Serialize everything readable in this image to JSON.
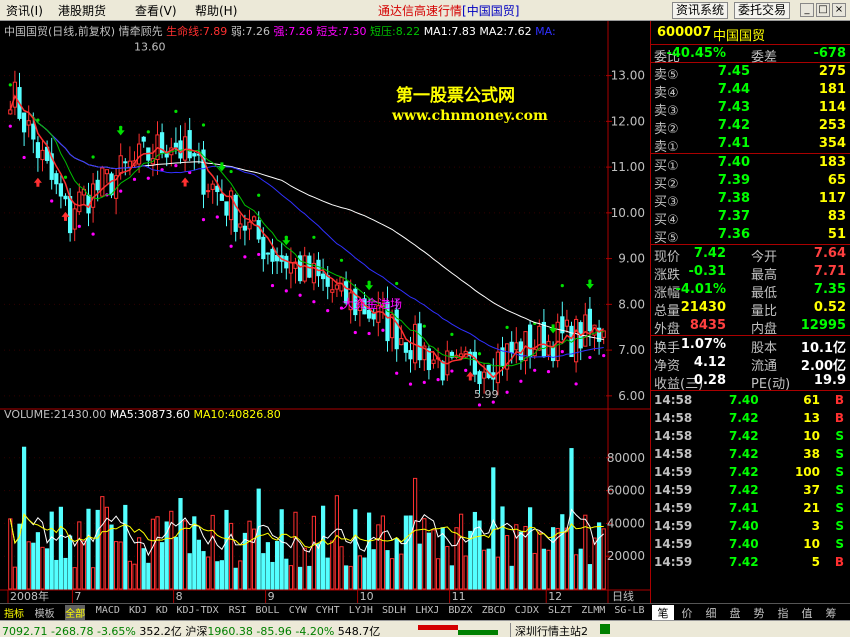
{
  "menu": {
    "items": [
      "资讯(I)",
      "港股期货",
      "查看(V)",
      "帮助(H)"
    ],
    "app_title": "通达信高速行情",
    "app_subtitle": "[中国国贸]",
    "btn_info": "资讯系统",
    "btn_trade": "委托交易"
  },
  "chart_header": {
    "title": "中国国贸(日线,前复权)",
    "indicator": "情牵顾先",
    "lifeline_label": "生命线:",
    "lifeline": "7.89",
    "weak_label": "弱:",
    "weak": "7.26",
    "strong_label": "强:",
    "strong": "7.26",
    "short_label": "短支:",
    "short": "7.30",
    "shortpress_label": "短压:",
    "shortpress": "8.22",
    "ma1_label": "MA1:",
    "ma1": "7.83",
    "ma2_label": "MA2:",
    "ma2": "7.62",
    "ma3_label": "MA:"
  },
  "watermark": {
    "line1": "第一股票公式网",
    "line2": "www.chnmoney.com",
    "note": "大资金进场"
  },
  "price_axis": [
    "13.00",
    "12.00",
    "11.00",
    "10.00",
    "9.00",
    "8.00",
    "7.00",
    "6.00"
  ],
  "high_marker": "13.60",
  "low_marker": "5.99",
  "volume_header": {
    "vol_label": "VOLUME:",
    "vol": "21430.00",
    "ma5_label": "MA5:",
    "ma5": "30873.60",
    "ma10_label": "MA10:",
    "ma10": "40826.80"
  },
  "volume_axis": [
    "80000",
    "60000",
    "40000",
    "20000"
  ],
  "month_labels": [
    "2008年",
    "7",
    "8",
    "9",
    "10",
    "11",
    "12"
  ],
  "period_label": "日线",
  "quote": {
    "code": "600007",
    "name": "中国国贸",
    "ratio_label": "委比",
    "ratio": "-40.45%",
    "diff_label": "委差",
    "diff": "-678",
    "asks": [
      {
        "label": "卖⑤",
        "price": "7.45",
        "vol": "275"
      },
      {
        "label": "卖④",
        "price": "7.44",
        "vol": "181"
      },
      {
        "label": "卖③",
        "price": "7.43",
        "vol": "114"
      },
      {
        "label": "卖②",
        "price": "7.42",
        "vol": "253"
      },
      {
        "label": "卖①",
        "price": "7.41",
        "vol": "354"
      }
    ],
    "bids": [
      {
        "label": "买①",
        "price": "7.40",
        "vol": "183"
      },
      {
        "label": "买②",
        "price": "7.39",
        "vol": "65"
      },
      {
        "label": "买③",
        "price": "7.38",
        "vol": "117"
      },
      {
        "label": "买④",
        "price": "7.37",
        "vol": "83"
      },
      {
        "label": "买⑤",
        "price": "7.36",
        "vol": "51"
      }
    ],
    "stats": [
      {
        "l1": "现价",
        "v1": "7.42",
        "c1": "#00ff00",
        "l2": "今开",
        "v2": "7.64",
        "c2": "#ff4040"
      },
      {
        "l1": "涨跌",
        "v1": "-0.31",
        "c1": "#00ff00",
        "l2": "最高",
        "v2": "7.71",
        "c2": "#ff4040"
      },
      {
        "l1": "涨幅",
        "v1": "-4.01%",
        "c1": "#00ff00",
        "l2": "最低",
        "v2": "7.35",
        "c2": "#00ff00"
      },
      {
        "l1": "总量",
        "v1": "21430",
        "c1": "#ffff00",
        "l2": "量比",
        "v2": "0.52",
        "c2": "#ffff00"
      },
      {
        "l1": "外盘",
        "v1": "8435",
        "c1": "#ff4040",
        "l2": "内盘",
        "v2": "12995",
        "c2": "#00ff00"
      }
    ],
    "fin": [
      {
        "l1": "换手",
        "v1": "1.07%",
        "l2": "股本",
        "v2": "10.1亿"
      },
      {
        "l1": "净资",
        "v1": "4.12",
        "l2": "流通",
        "v2": "2.00亿"
      },
      {
        "l1": "收益(三)",
        "v1": "0.28",
        "l2": "PE(动)",
        "v2": "19.9"
      }
    ],
    "ticks": [
      {
        "time": "14:58",
        "price": "7.40",
        "vol": "61",
        "bs": "B"
      },
      {
        "time": "14:58",
        "price": "7.42",
        "vol": "13",
        "bs": "B"
      },
      {
        "time": "14:58",
        "price": "7.42",
        "vol": "10",
        "bs": "S"
      },
      {
        "time": "14:58",
        "price": "7.42",
        "vol": "38",
        "bs": "S"
      },
      {
        "time": "14:59",
        "price": "7.42",
        "vol": "100",
        "bs": "S"
      },
      {
        "time": "14:59",
        "price": "7.42",
        "vol": "37",
        "bs": "S"
      },
      {
        "time": "14:59",
        "price": "7.41",
        "vol": "21",
        "bs": "S"
      },
      {
        "time": "14:59",
        "price": "7.40",
        "vol": "3",
        "bs": "S"
      },
      {
        "time": "14:59",
        "price": "7.40",
        "vol": "10",
        "bs": "S"
      },
      {
        "time": "14:59",
        "price": "7.42",
        "vol": "5",
        "bs": "B"
      }
    ]
  },
  "tabs": [
    "指标",
    "模板",
    "全部",
    "MACD",
    "KDJ",
    "KD",
    "KDJ-TDX",
    "RSI",
    "BOLL",
    "CYW",
    "CYHT",
    "LYJH",
    "SDLH",
    "LHXJ",
    "BDZX",
    "ZBCD",
    "CJDX",
    "SLZT",
    "ZLMM",
    "SG-LB"
  ],
  "right_tabs": [
    "笔",
    "价",
    "细",
    "盘",
    "势",
    "指",
    "值",
    "筹"
  ],
  "status": {
    "sh_index": "7092.71",
    "sh_chg": "-268.78",
    "sh_pct": "-3.65%",
    "sh_amt": "352.2亿",
    "hs_label": "沪深",
    "hs_index": "1960.38",
    "hs_chg": "-85.96",
    "hs_pct": "-4.20%",
    "hs_amt": "548.7亿",
    "server": "深圳行情主站2"
  },
  "colors": {
    "up": "#ff3030",
    "down": "#54ffff",
    "ma_white": "#ffffff",
    "ma_blue": "#3030ff",
    "ma_green": "#00c000",
    "ma_yellow": "#ffff00",
    "dot_green": "#00e000",
    "dot_magenta": "#ff00ff"
  },
  "chart_data": {
    "type": "candlestick",
    "symbol": "600007",
    "period": "日线",
    "price_range": [
      5.8,
      13.8
    ],
    "volume_range": [
      0,
      100000
    ],
    "segments": [
      {
        "month": "2008-06",
        "close_start": 12.7,
        "close_end": 9.8
      },
      {
        "month": "2008-07",
        "close_start": 10.2,
        "close_end": 11.6
      },
      {
        "month": "2008-08",
        "close_start": 11.5,
        "close_end": 9.3
      },
      {
        "month": "2008-09",
        "close_start": 9.2,
        "close_end": 8.0
      },
      {
        "month": "2008-10",
        "close_start": 8.0,
        "close_end": 6.6
      },
      {
        "month": "2008-11",
        "close_start": 6.5,
        "close_end": 7.2
      },
      {
        "month": "2008-12",
        "close_start": 7.2,
        "close_end": 7.42
      }
    ],
    "last_close": 7.42,
    "high": 13.6,
    "low": 5.99
  }
}
